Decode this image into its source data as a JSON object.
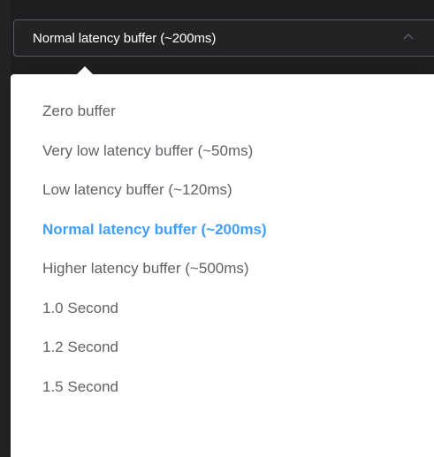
{
  "select": {
    "value": "Normal latency buffer (~200ms)",
    "arrow_icon": "chevron-up-icon",
    "expanded": true
  },
  "dropdown": {
    "options": [
      {
        "label": "Zero buffer",
        "selected": false
      },
      {
        "label": "Very low latency buffer (~50ms)",
        "selected": false
      },
      {
        "label": "Low latency buffer (~120ms)",
        "selected": false
      },
      {
        "label": "Normal latency buffer (~200ms)",
        "selected": true
      },
      {
        "label": "Higher latency buffer (~500ms)",
        "selected": false
      },
      {
        "label": "1.0 Second",
        "selected": false
      },
      {
        "label": "1.2 Second",
        "selected": false
      },
      {
        "label": "1.5 Second",
        "selected": false
      }
    ]
  },
  "colors": {
    "selected_option": "#409eff",
    "option_text": "#606266",
    "select_text": "#ffffff",
    "select_background": "#232326"
  }
}
